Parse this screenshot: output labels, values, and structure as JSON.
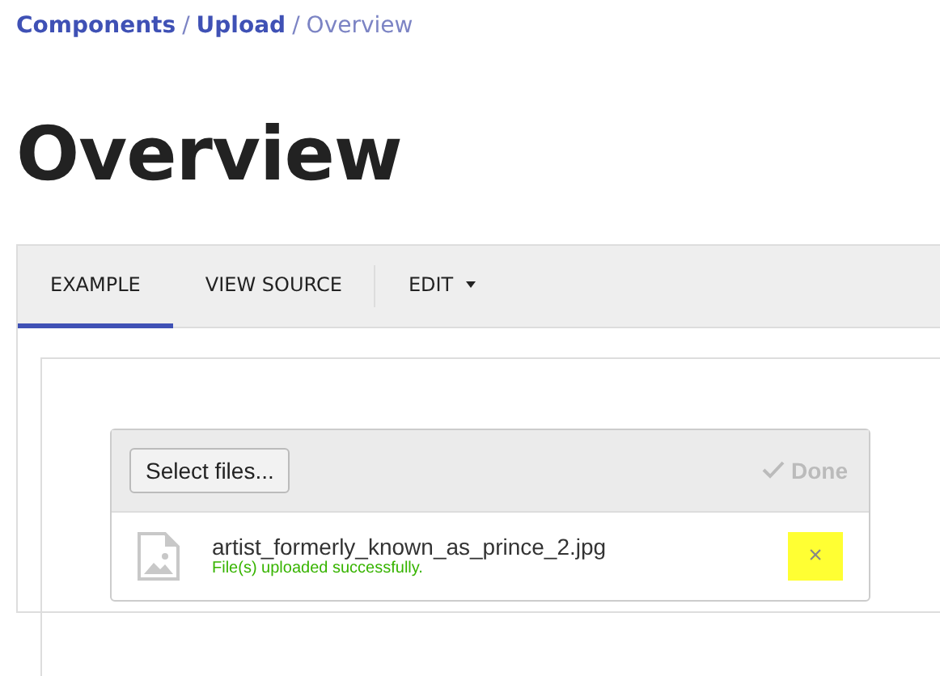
{
  "breadcrumb": [
    {
      "label": "Components",
      "kind": "link"
    },
    {
      "label": "/",
      "kind": "separator"
    },
    {
      "label": "Upload",
      "kind": "link"
    },
    {
      "label": "/",
      "kind": "separator"
    },
    {
      "label": "Overview",
      "kind": "current"
    }
  ],
  "heading": "Overview",
  "tabs": [
    {
      "label": "EXAMPLE",
      "selected": true,
      "kind": "tab"
    },
    {
      "label": "VIEW SOURCE",
      "selected": false,
      "kind": "tab"
    },
    {
      "label": "EDIT",
      "selected": false,
      "kind": "menu"
    }
  ],
  "upload": {
    "select_button": "Select files...",
    "done_button": {
      "label": "Done",
      "disabled": true
    },
    "files": [
      {
        "name": "artist_formerly_known_as_prince_2.jpg",
        "status": "File(s) uploaded successfully.",
        "remove_icon": "×",
        "highlighted": true
      }
    ]
  }
}
